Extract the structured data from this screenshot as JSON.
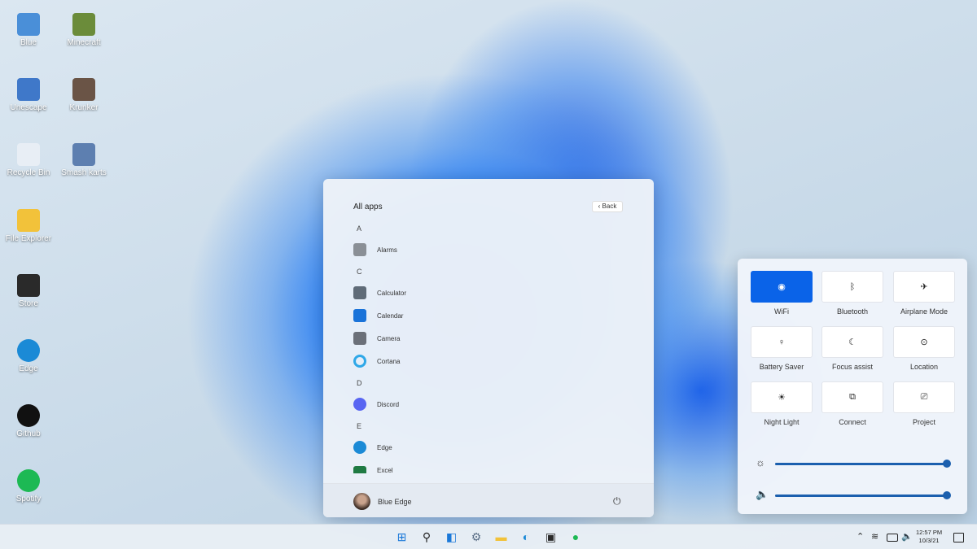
{
  "desktop": {
    "icons": [
      {
        "label": "Blue",
        "color": "#4a8fd8"
      },
      {
        "label": "Minecraft",
        "color": "#6b8c3a"
      },
      {
        "label": "Unescape",
        "color": "#3f78c9"
      },
      {
        "label": "Krunker",
        "color": "#6a5446"
      },
      {
        "label": "Recycle Bin",
        "color": "#e8eef5"
      },
      {
        "label": "Smash karts",
        "color": "#5d7fb0"
      },
      {
        "label": "File Explorer",
        "color": "#f2c23a"
      },
      {
        "label": "Store",
        "color": "#2a2a2a"
      },
      {
        "label": "Edge",
        "color": "#1b8ad6"
      },
      {
        "label": "Github",
        "color": "#111111"
      },
      {
        "label": "Spotify",
        "color": "#1db954"
      }
    ]
  },
  "start": {
    "title": "All apps",
    "back": "Back",
    "groups": [
      {
        "letter": "A"
      },
      {
        "letter": "C"
      },
      {
        "letter": "D"
      },
      {
        "letter": "E"
      }
    ],
    "apps": [
      {
        "label": "Alarms",
        "color": "#8a8f96"
      },
      {
        "label": "Calculator",
        "color": "#5f6b78"
      },
      {
        "label": "Calendar",
        "color": "#1a73d9"
      },
      {
        "label": "Camera",
        "color": "#6b7079"
      },
      {
        "label": "Cortana",
        "color": "#2fa8e8"
      },
      {
        "label": "Discord",
        "color": "#5865f2"
      },
      {
        "label": "Edge",
        "color": "#1b8ad6"
      },
      {
        "label": "Excel",
        "color": "#1f7a43"
      }
    ],
    "user": "Blue Edge",
    "power_icon": "⏻"
  },
  "quick_settings": {
    "tiles": [
      {
        "label": "WiFi",
        "icon": "wifi-icon",
        "glyph": "◉",
        "active": true
      },
      {
        "label": "Bluetooth",
        "icon": "bluetooth-icon",
        "glyph": "ᛒ",
        "active": false
      },
      {
        "label": "Airplane Mode",
        "icon": "airplane-icon",
        "glyph": "✈",
        "active": false
      },
      {
        "label": "Battery Saver",
        "icon": "battery-saver-icon",
        "glyph": "♀",
        "active": false
      },
      {
        "label": "Focus assist",
        "icon": "moon-icon",
        "glyph": "☾",
        "active": false
      },
      {
        "label": "Location",
        "icon": "location-icon",
        "glyph": "⊙",
        "active": false
      },
      {
        "label": "Night Light",
        "icon": "sun-icon",
        "glyph": "☀",
        "active": false
      },
      {
        "label": "Connect",
        "icon": "connect-icon",
        "glyph": "⧉",
        "active": false
      },
      {
        "label": "Project",
        "icon": "project-icon",
        "glyph": "⎚",
        "active": false
      }
    ],
    "brightness": 100,
    "volume": 100,
    "brightness_icon": "☼",
    "volume_icon": "🔈"
  },
  "taskbar": {
    "icons": [
      {
        "name": "windows-start-icon",
        "glyph": "⊞",
        "color": "#1a78d8"
      },
      {
        "name": "search-icon",
        "glyph": "⚲",
        "color": "#222"
      },
      {
        "name": "task-view-icon",
        "glyph": "◧",
        "color": "#1a78d8"
      },
      {
        "name": "settings-icon",
        "glyph": "⚙",
        "color": "#5a6e86"
      },
      {
        "name": "file-explorer-icon",
        "glyph": "▬",
        "color": "#f2c23a"
      },
      {
        "name": "edge-icon",
        "glyph": "◐",
        "color": "#1b8ad6"
      },
      {
        "name": "store-icon",
        "glyph": "▣",
        "color": "#2a2a2a"
      },
      {
        "name": "spotify-icon",
        "glyph": "●",
        "color": "#1db954"
      }
    ],
    "time": "12:57 PM",
    "date": "10/3/21"
  }
}
